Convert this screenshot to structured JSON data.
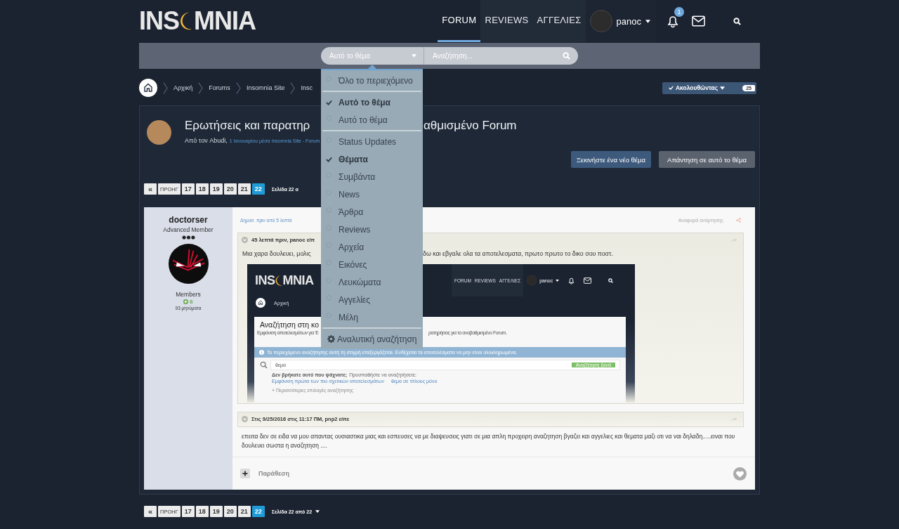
{
  "header": {
    "logo": {
      "left": "INS",
      "right": "MNIA"
    },
    "nav": [
      {
        "label": "FORUM",
        "selected": true
      },
      {
        "label": "REVIEWS",
        "selected": false
      },
      {
        "label": "ΑΓΓΕΛΙΕΣ",
        "selected": false
      }
    ],
    "user": "panoc",
    "notifications": "1"
  },
  "search": {
    "scope": "Αυτό το θέμα",
    "placeholder": "Αναζήτηση...",
    "menu": {
      "groups": [
        [
          {
            "label": "Όλο το περιεχόμενο",
            "selected": false
          }
        ],
        [
          {
            "label": "Αυτό το θέμα",
            "selected": true
          },
          {
            "label": "Αυτό το θέμα",
            "selected": false
          }
        ],
        [
          {
            "label": "Status Updates",
            "selected": false
          },
          {
            "label": "Θέματα",
            "selected": true
          },
          {
            "label": "Συμβάντα",
            "selected": false
          },
          {
            "label": "News",
            "selected": false
          },
          {
            "label": "Άρθρα",
            "selected": false
          },
          {
            "label": "Reviews",
            "selected": false
          },
          {
            "label": "Αρχεία",
            "selected": false
          },
          {
            "label": "Εικόνες",
            "selected": false
          },
          {
            "label": "Λευκώματα",
            "selected": false
          },
          {
            "label": "Αγγελίες",
            "selected": false
          },
          {
            "label": "Μέλη",
            "selected": false
          }
        ]
      ],
      "advanced": "Αναλυτική αναζήτηση"
    }
  },
  "breadcrumbs": [
    "Αρχική",
    "Forums",
    "Insomnia Site",
    "Insc"
  ],
  "follow": {
    "label": "Ακολουθώντας",
    "count": "25"
  },
  "topic": {
    "title_parts": [
      "Ερωτήσεις και παρατηρ",
      "αθμισμένο Forum"
    ],
    "by": "Από τον Abudi,",
    "meta": "1 Ιανουαρίου μέσα Insomnia Site - Forum",
    "buttons": [
      "Ξεκινήστε ένα νέο θέμα",
      "Απάντηση σε αυτό το θέμα"
    ]
  },
  "pagination_top": {
    "first": "«",
    "prev": "ΠΡΟΗΓ",
    "pages": [
      {
        "label": "17",
        "selected": false
      },
      {
        "label": "18",
        "selected": false
      },
      {
        "label": "19",
        "selected": false
      },
      {
        "label": "20",
        "selected": false
      },
      {
        "label": "21",
        "selected": false
      },
      {
        "label": "22",
        "selected": true
      }
    ],
    "info": "Σελίδα 22 α"
  },
  "post": {
    "author": {
      "name": "doctorser",
      "rank": "Advanced Member",
      "group": "Members",
      "reputation": "6",
      "posts": "93 μηνύματα"
    },
    "posted": "Δημοσ. πριν από 5 λεπτά",
    "report": "Αναφορά ανάρτησης",
    "quote": {
      "header": "45 λεπτά πριν, panoc είπ",
      "text_parts": [
        "Μια χαρα δουλευει, μολις",
        "δω και εβγαλε ολα τα αποτελεσματα, πρωτο πρωτο το δικο σου ποστ."
      ],
      "screenshot": {
        "logo": {
          "left": "INS",
          "right": "MNIA"
        },
        "nav": [
          "FORUM",
          "REVIEWS",
          "ΑΓΓΕΛΙΕΣ"
        ],
        "user": "panoc",
        "breadcrumb": "Αρχική",
        "heading": "Αναζήτηση στη κο",
        "subtitle_parts": [
          "Εμφάνιση αποτελεσμάτων για 'Ε",
          "ρατηρήσεις για το αναβαθμισμένο Forum."
        ],
        "notice": "Το περιεχόμενο αναζήτησης αυτή τη στιγμή επεξεργάζεται. Ενδέχεται τα αποτελέσματα να μην είναι ολοκληρωμένα.",
        "search_value": "θεμα",
        "search_button": "Αναζήτηση ξανά",
        "not_found": "Δεν βρήκατε αυτό που ψάχνατε;",
        "try": "Προσπαθήστε να αναζητήσετε:",
        "suggestions": [
          "Εμφάνιση πρώτα των πιο σχετικών αποτελεσμάτων",
          "θεμα σε τίτλους μόνο"
        ],
        "more": "+ Περισσότερες επιλογές αναζήτησης"
      }
    },
    "quote2": {
      "header": "Στις 9/25/2016 στις 11:17 ΠΜ, pnp2 είπε"
    },
    "text": "επειτα δεν σε ειδα να μου απαντας ουσιαστικα μιας και εσπευσες να με διαψευσεις γιατι σε μια απλη προχειρη αναζητηση βγαζει και αγγελιες και θεματα μαζι οτι να ναι δηλαδη.....ειναι που δουλευει σωστα η αναζητηση ....",
    "quote_button": "Παράθεση"
  },
  "pagination_bottom": {
    "first": "«",
    "prev": "ΠΡΟΗΓ",
    "pages": [
      {
        "label": "17",
        "selected": false
      },
      {
        "label": "18",
        "selected": false
      },
      {
        "label": "19",
        "selected": false
      },
      {
        "label": "20",
        "selected": false
      },
      {
        "label": "21",
        "selected": false
      },
      {
        "label": "22",
        "selected": true
      }
    ],
    "info": "Σελίδα 22 από 22"
  }
}
